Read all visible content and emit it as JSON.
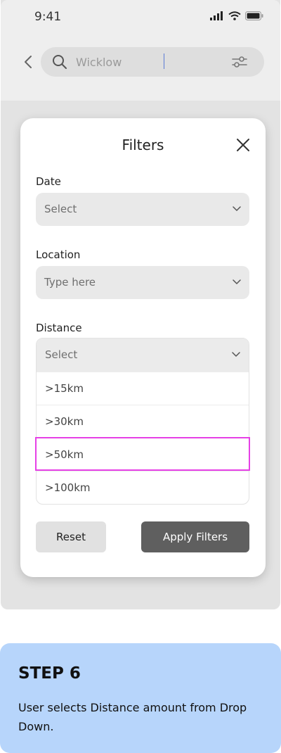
{
  "status_bar": {
    "time": "9:41"
  },
  "search": {
    "value": "Wicklow",
    "placeholder": "Wicklow"
  },
  "filters_modal": {
    "title": "Filters",
    "date": {
      "label": "Date",
      "value": "Select"
    },
    "location": {
      "label": "Location",
      "value": "Type here"
    },
    "distance": {
      "label": "Distance",
      "value": "Select",
      "options": [
        ">15km",
        ">30km",
        ">50km",
        ">100km"
      ],
      "highlighted_option": ">50km"
    },
    "reset_label": "Reset",
    "apply_label": "Apply Filters"
  },
  "step": {
    "title": "STEP 6",
    "description": "User selects Distance amount from Drop Down."
  },
  "colors": {
    "highlight": "#e640e6",
    "step_card": "#b7d5fb",
    "apply_button": "#5f5f5f"
  }
}
